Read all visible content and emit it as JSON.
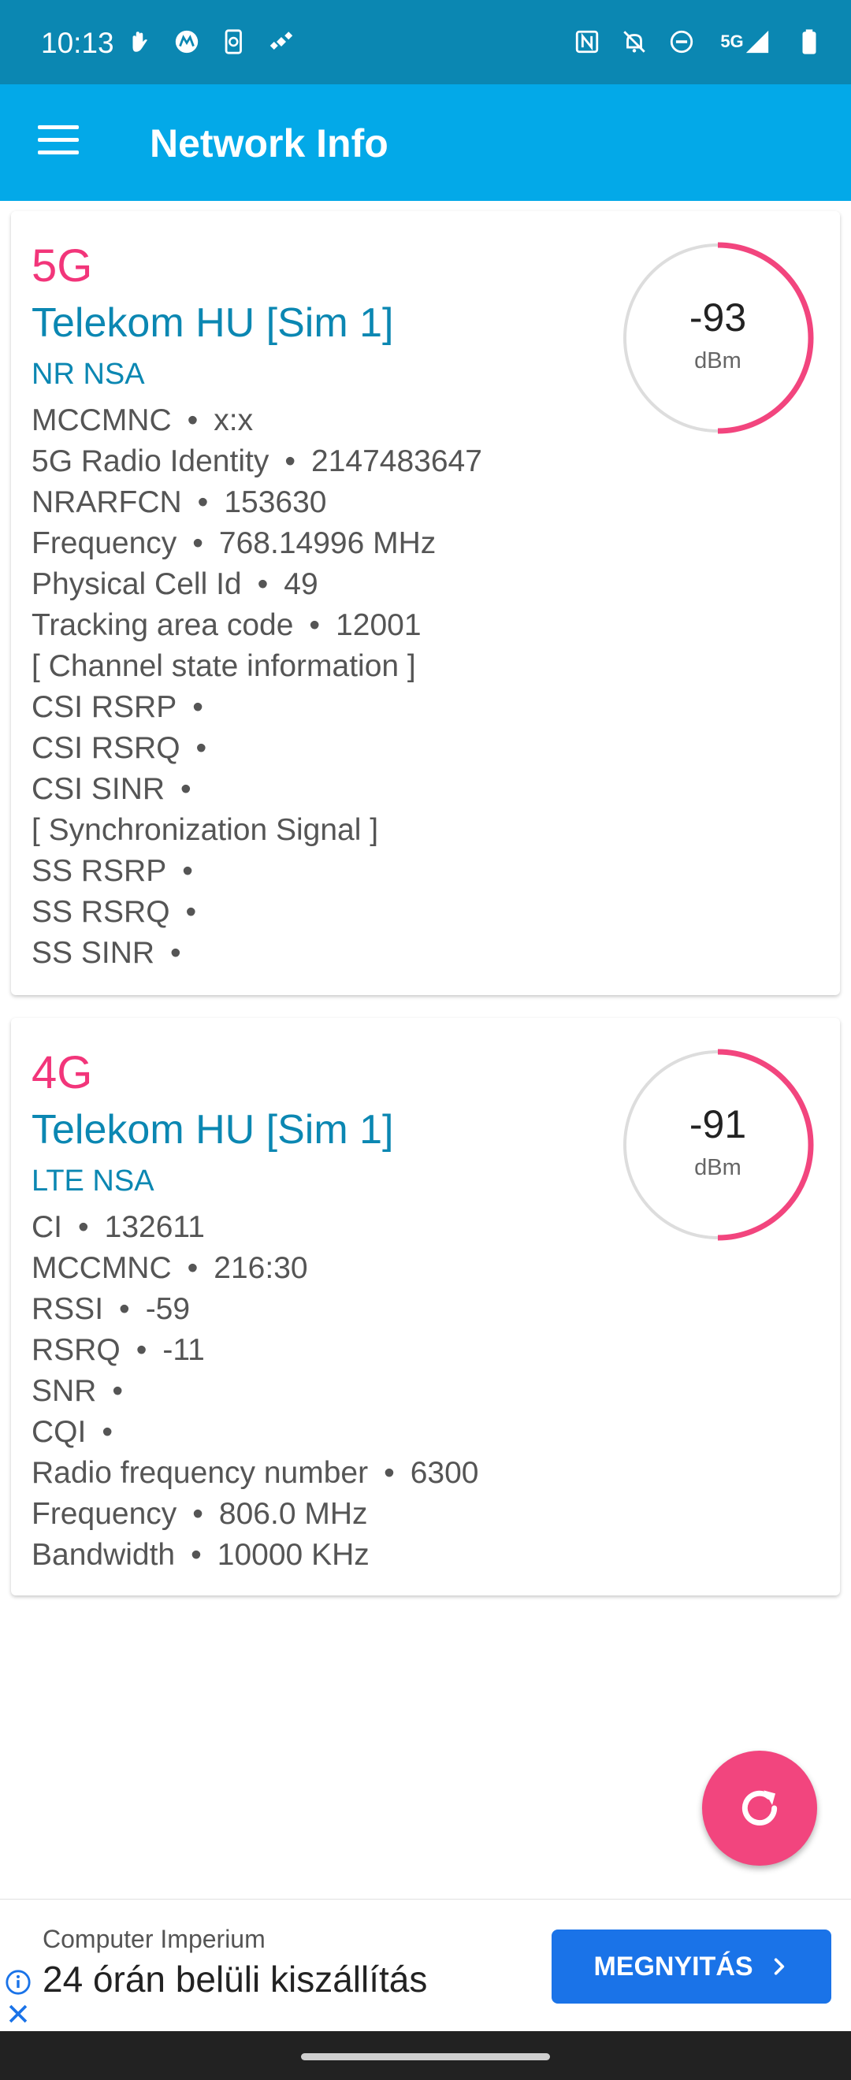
{
  "status_bar": {
    "time": "10:13",
    "left_icons": [
      "hand-wave-icon",
      "motorola-icon",
      "phone-sync-icon",
      "satellite-icon"
    ],
    "right_icons": [
      "nfc-icon",
      "silent-bell-icon",
      "do-not-disturb-icon",
      "5g-signal-icon",
      "battery-icon"
    ],
    "network_label": "5G"
  },
  "app_bar": {
    "title": "Network Info"
  },
  "cards": [
    {
      "network_type": "5G",
      "operator": "Telekom HU [Sim 1]",
      "technology": "NR NSA",
      "signal": {
        "value": "-93",
        "unit": "dBm",
        "level": 0.5
      },
      "rows": [
        {
          "label": "MCCMNC",
          "value": "x:x"
        },
        {
          "label": "5G Radio Identity",
          "value": "2147483647"
        },
        {
          "label": "NRARFCN",
          "value": "153630"
        },
        {
          "label": "Frequency",
          "value": "768.14996 MHz"
        },
        {
          "label": "Physical Cell Id",
          "value": "49"
        },
        {
          "label": "Tracking area code",
          "value": "12001"
        },
        {
          "label": "[ Channel state information ]"
        },
        {
          "label": "CSI RSRP",
          "value": ""
        },
        {
          "label": "CSI RSRQ",
          "value": ""
        },
        {
          "label": "CSI SINR",
          "value": ""
        },
        {
          "label": "[ Synchronization Signal ]"
        },
        {
          "label": "SS RSRP",
          "value": ""
        },
        {
          "label": "SS RSRQ",
          "value": ""
        },
        {
          "label": "SS SINR",
          "value": ""
        }
      ]
    },
    {
      "network_type": "4G",
      "operator": "Telekom HU [Sim 1]",
      "technology": "LTE NSA",
      "signal": {
        "value": "-91",
        "unit": "dBm",
        "level": 0.5
      },
      "rows": [
        {
          "label": "CI",
          "value": "132611"
        },
        {
          "label": "MCCMNC",
          "value": "216:30"
        },
        {
          "label": "RSSI",
          "value": "-59"
        },
        {
          "label": "RSRQ",
          "value": "-11"
        },
        {
          "label": "SNR",
          "value": ""
        },
        {
          "label": "CQI",
          "value": ""
        },
        {
          "label": "Radio frequency number",
          "value": "6300"
        },
        {
          "label": "Frequency",
          "value": "806.0 MHz"
        },
        {
          "label": "Bandwidth",
          "value": "10000 KHz"
        }
      ]
    }
  ],
  "fab": {
    "icon": "refresh-icon"
  },
  "ad": {
    "advertiser": "Computer Imperium",
    "headline": "24 órán belüli kiszállítás",
    "cta": "MEGNYITÁS"
  },
  "colors": {
    "status_bar": "#0b87b2",
    "app_bar": "#03a9e8",
    "network_type": "#f2357a",
    "operator": "#0b87b2",
    "gauge_arc": "#f2457e",
    "gauge_track": "#dddddd",
    "fab": "#f2457e",
    "ad_button": "#1a73e8"
  }
}
